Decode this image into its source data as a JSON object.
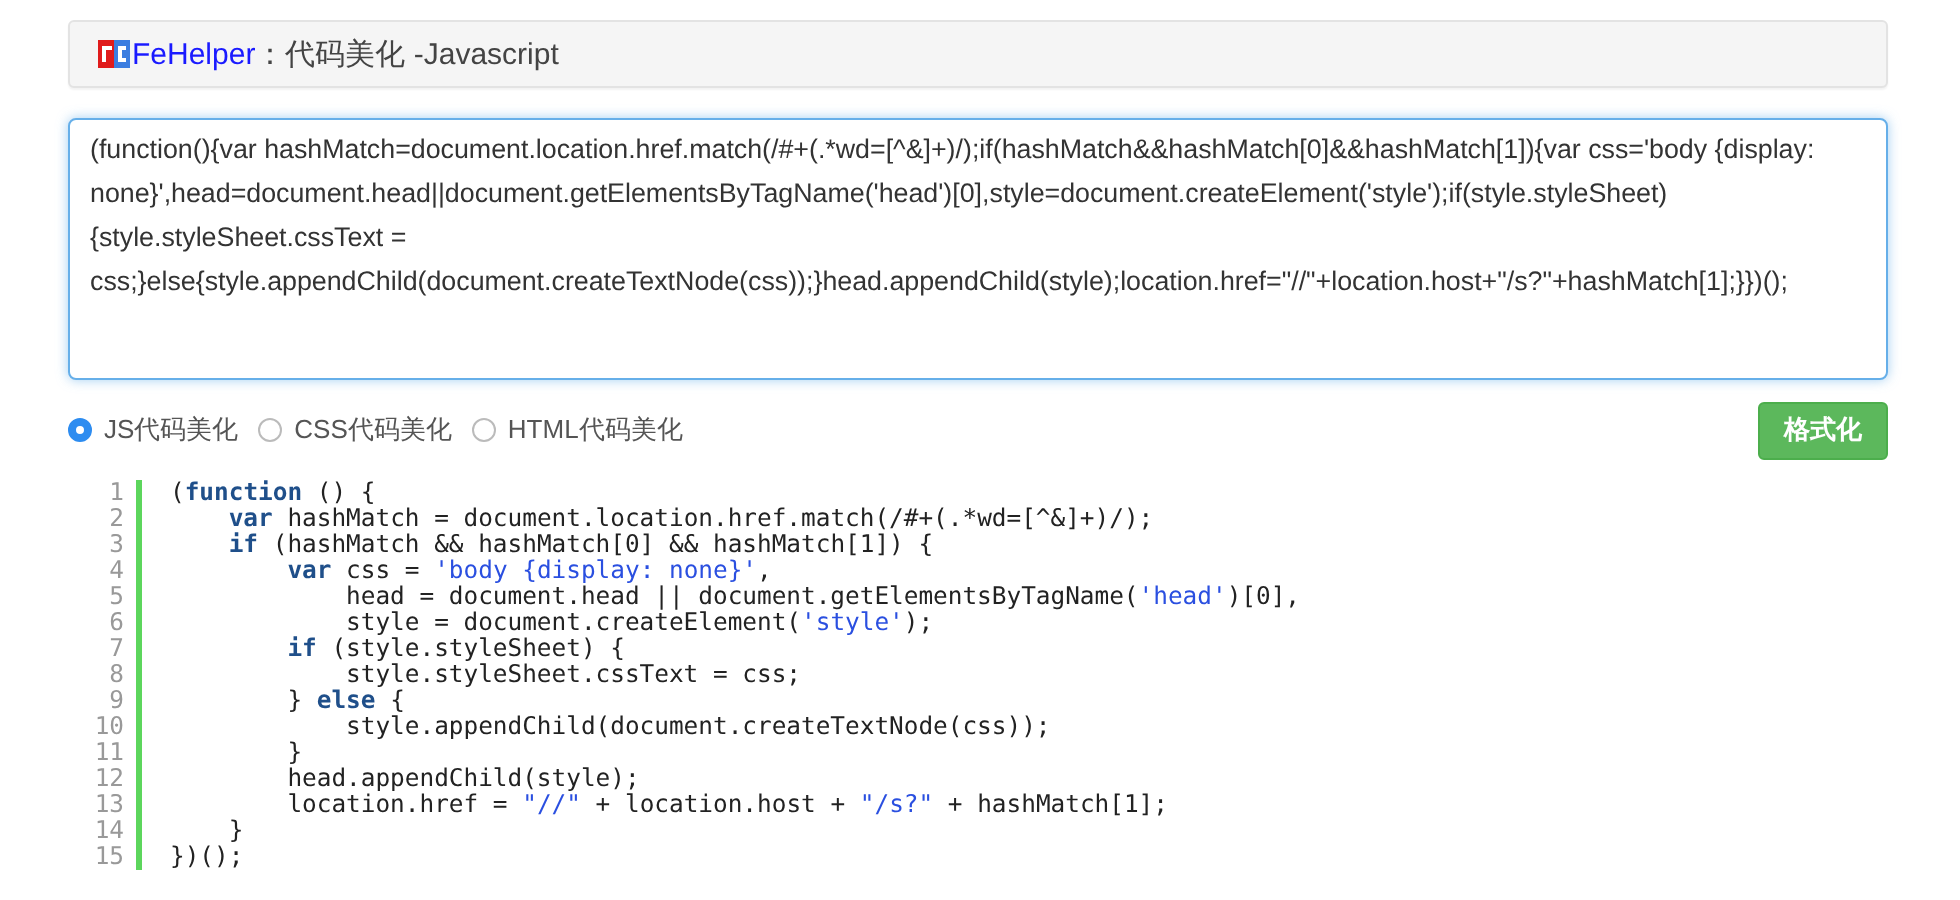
{
  "header": {
    "brand": "FeHelper",
    "title": "：代码美化 -Javascript"
  },
  "input": {
    "value": "(function(){var hashMatch=document.location.href.match(/#+(.*wd=[^&]+)/);if(hashMatch&&hashMatch[0]&&hashMatch[1]){var css='body {display: none}',head=document.head||document.getElementsByTagName('head')[0],style=document.createElement('style');if(style.styleSheet){style.styleSheet.cssText = css;}else{style.appendChild(document.createTextNode(css));}head.appendChild(style);location.href=\"//\"+location.host+\"/s?\"+hashMatch[1];}})();"
  },
  "modes": [
    {
      "label": "JS代码美化",
      "selected": true
    },
    {
      "label": "CSS代码美化",
      "selected": false
    },
    {
      "label": "HTML代码美化",
      "selected": false
    }
  ],
  "format_button": "格式化",
  "code": [
    {
      "number": "1",
      "tokens": [
        {
          "kind": "plain",
          "text": "("
        },
        {
          "kind": "keyword",
          "text": "function"
        },
        {
          "kind": "plain",
          "text": " () {"
        }
      ]
    },
    {
      "number": "2",
      "tokens": [
        {
          "kind": "keyword",
          "text": "    var"
        },
        {
          "kind": "plain",
          "text": " hashMatch = document.location.href.match(/#+(.*wd=[^&]+)/);"
        }
      ]
    },
    {
      "number": "3",
      "tokens": [
        {
          "kind": "keyword",
          "text": "    if"
        },
        {
          "kind": "plain",
          "text": " (hashMatch && hashMatch[0] && hashMatch[1]) {"
        }
      ]
    },
    {
      "number": "4",
      "tokens": [
        {
          "kind": "keyword",
          "text": "        var"
        },
        {
          "kind": "plain",
          "text": " css = "
        },
        {
          "kind": "string",
          "text": "'body {display: none}'"
        },
        {
          "kind": "plain",
          "text": ","
        }
      ]
    },
    {
      "number": "5",
      "tokens": [
        {
          "kind": "plain",
          "text": "            head = document.head || document.getElementsByTagName("
        },
        {
          "kind": "string",
          "text": "'head'"
        },
        {
          "kind": "plain",
          "text": ")[0],"
        }
      ]
    },
    {
      "number": "6",
      "tokens": [
        {
          "kind": "plain",
          "text": "            style = document.createElement("
        },
        {
          "kind": "string",
          "text": "'style'"
        },
        {
          "kind": "plain",
          "text": ");"
        }
      ]
    },
    {
      "number": "7",
      "tokens": [
        {
          "kind": "keyword",
          "text": "        if"
        },
        {
          "kind": "plain",
          "text": " (style.styleSheet) {"
        }
      ]
    },
    {
      "number": "8",
      "tokens": [
        {
          "kind": "plain",
          "text": "            style.styleSheet.cssText = css;"
        }
      ]
    },
    {
      "number": "9",
      "tokens": [
        {
          "kind": "plain",
          "text": "        } "
        },
        {
          "kind": "keyword",
          "text": "else"
        },
        {
          "kind": "plain",
          "text": " {"
        }
      ]
    },
    {
      "number": "10",
      "tokens": [
        {
          "kind": "plain",
          "text": "            style.appendChild(document.createTextNode(css));"
        }
      ]
    },
    {
      "number": "11",
      "tokens": [
        {
          "kind": "plain",
          "text": "        }"
        }
      ]
    },
    {
      "number": "12",
      "tokens": [
        {
          "kind": "plain",
          "text": "        head.appendChild(style);"
        }
      ]
    },
    {
      "number": "13",
      "tokens": [
        {
          "kind": "plain",
          "text": "        location.href = "
        },
        {
          "kind": "string",
          "text": "\"//\""
        },
        {
          "kind": "plain",
          "text": " + location.host + "
        },
        {
          "kind": "string",
          "text": "\"/s?\""
        },
        {
          "kind": "plain",
          "text": " + hashMatch[1];"
        }
      ]
    },
    {
      "number": "14",
      "tokens": [
        {
          "kind": "plain",
          "text": "    }"
        }
      ]
    },
    {
      "number": "15",
      "tokens": [
        {
          "kind": "plain",
          "text": "})();"
        }
      ]
    }
  ]
}
